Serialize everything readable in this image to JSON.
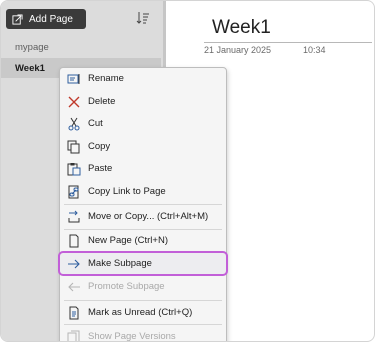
{
  "sidebar": {
    "add_page_label": "Add Page",
    "pages": [
      {
        "label": "mypage",
        "selected": false
      },
      {
        "label": "Week1",
        "selected": true
      }
    ]
  },
  "page": {
    "title": "Week1",
    "date": "21 January 2025",
    "time": "10:34"
  },
  "context_menu": {
    "items": [
      {
        "label": "Rename",
        "icon": "rename-icon",
        "disabled": false
      },
      {
        "label": "Delete",
        "icon": "delete-x-icon",
        "disabled": false
      },
      {
        "label": "Cut",
        "icon": "scissors-icon",
        "disabled": false
      },
      {
        "label": "Copy",
        "icon": "copy-icon",
        "disabled": false
      },
      {
        "label": "Paste",
        "icon": "paste-icon",
        "disabled": false
      },
      {
        "label": "Copy Link to Page",
        "icon": "link-page-icon",
        "disabled": false
      },
      {
        "label": "Move or Copy...  (Ctrl+Alt+M)",
        "icon": "move-copy-icon",
        "disabled": false
      },
      {
        "label": "New Page  (Ctrl+N)",
        "icon": "new-page-icon",
        "disabled": false
      },
      {
        "label": "Make Subpage",
        "icon": "arrow-right-icon",
        "disabled": false,
        "highlighted": true
      },
      {
        "label": "Promote Subpage",
        "icon": "arrow-left-icon",
        "disabled": true
      },
      {
        "label": "Mark as Unread  (Ctrl+Q)",
        "icon": "mark-unread-icon",
        "disabled": false
      },
      {
        "label": "Show Page Versions",
        "icon": "page-versions-icon",
        "disabled": true
      }
    ],
    "highlight_color": "#c25fd8"
  }
}
